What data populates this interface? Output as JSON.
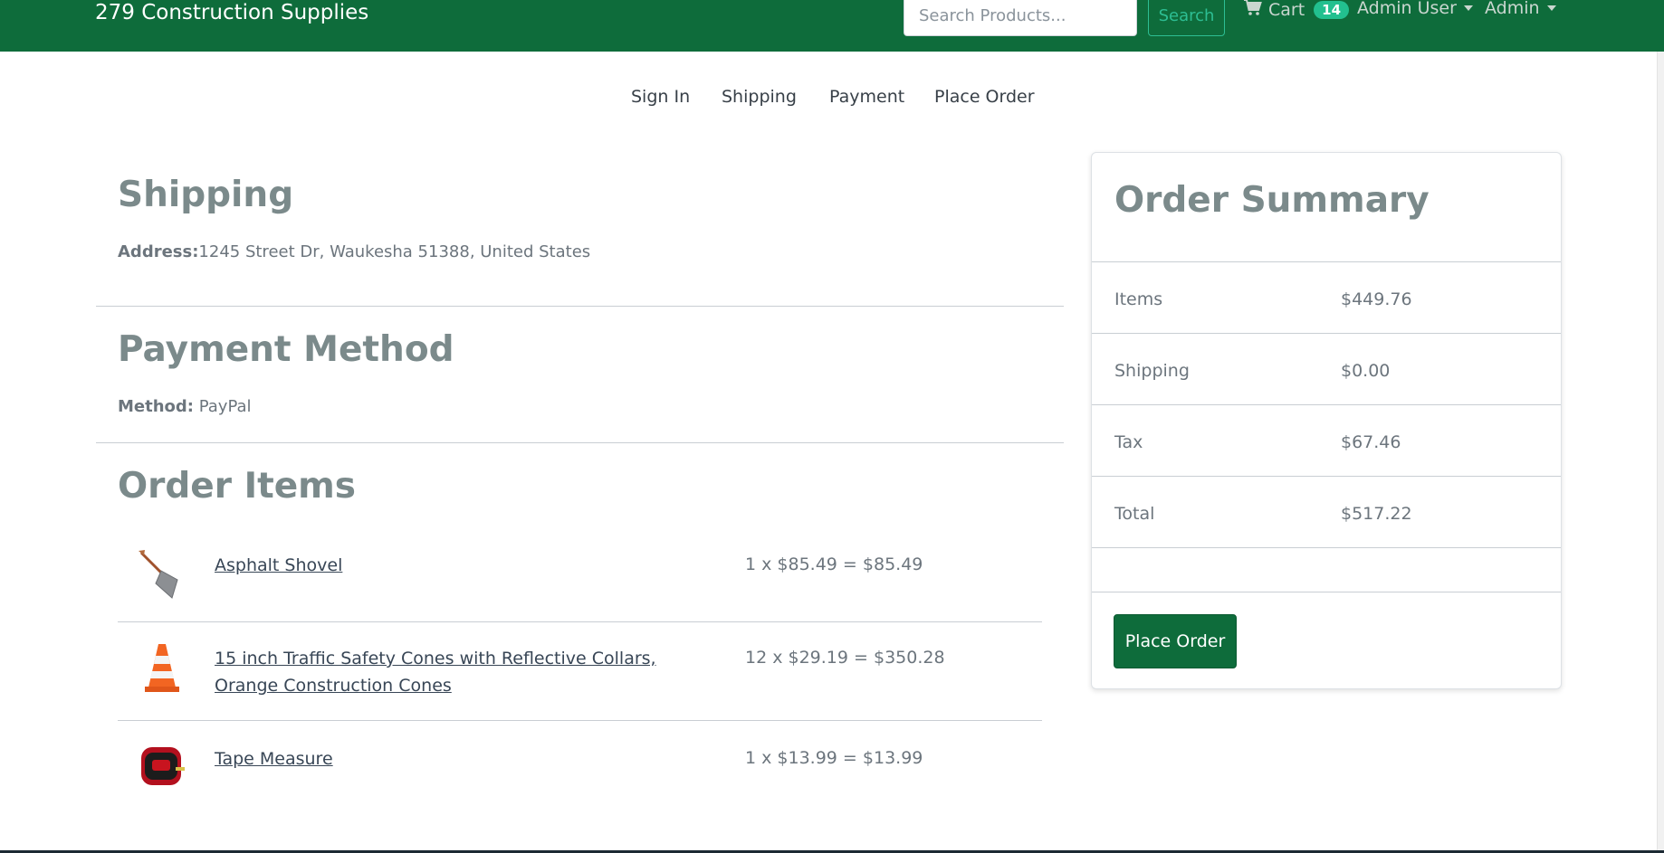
{
  "navbar": {
    "brand": "279 Construction Supplies",
    "search_placeholder": "Search Products...",
    "search_button": "Search",
    "cart_label": "Cart",
    "cart_count": "14",
    "user_menu": "Admin User",
    "admin_menu": "Admin"
  },
  "steps": [
    "Sign In",
    "Shipping",
    "Payment",
    "Place Order"
  ],
  "shipping": {
    "title": "Shipping",
    "address_label": "Address:",
    "address_value": "1245 Street Dr, Waukesha 51388, United States"
  },
  "payment": {
    "title": "Payment Method",
    "method_label": "Method:",
    "method_value": "PayPal"
  },
  "order_items": {
    "title": "Order Items",
    "items": [
      {
        "name": "Asphalt Shovel",
        "price_line": "1 x $85.49 = $85.49",
        "icon": "shovel-icon"
      },
      {
        "name": "15 inch Traffic Safety Cones with Reflective Collars, Orange Construction Cones",
        "price_line": "12 x $29.19 = $350.28",
        "icon": "traffic-cone-icon"
      },
      {
        "name": "Tape Measure",
        "price_line": "1 x $13.99 = $13.99",
        "icon": "tape-measure-icon"
      }
    ]
  },
  "summary": {
    "title": "Order Summary",
    "rows": [
      {
        "label": "Items",
        "value": "$449.76"
      },
      {
        "label": "Shipping",
        "value": "$0.00"
      },
      {
        "label": "Tax",
        "value": "$67.46"
      },
      {
        "label": "Total",
        "value": "$517.22"
      }
    ],
    "place_order": "Place Order"
  },
  "colors": {
    "navbar": "#0e6c3b",
    "accent": "#22c08f",
    "button": "#0e6c3b"
  }
}
